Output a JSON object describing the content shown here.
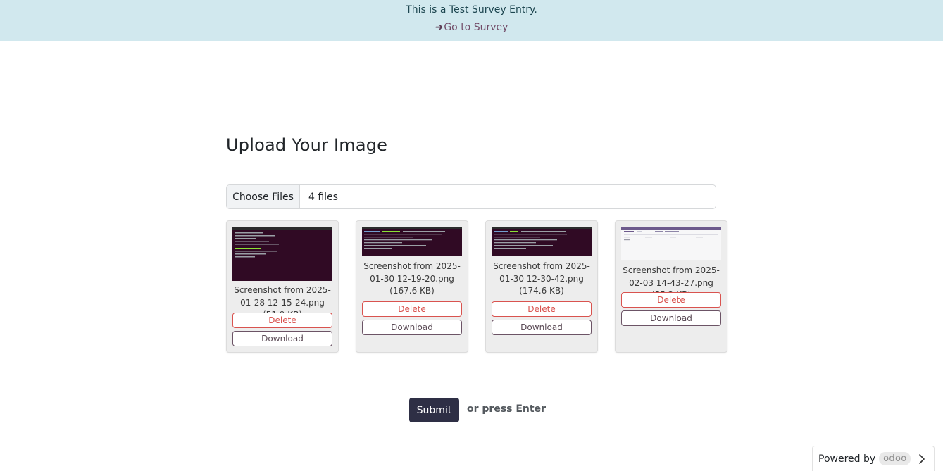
{
  "banner": {
    "text": "This is a Test Survey Entry.",
    "link_label": "Go to Survey",
    "arrow": "➜"
  },
  "page": {
    "title": "Upload Your Image"
  },
  "file_input": {
    "button_label": "Choose Files",
    "value": "4 files"
  },
  "files": [
    {
      "caption": "Screenshot from 2025-01-28 12-15-24.png (51.9 KB)",
      "thumb_style": "dark",
      "delete_label": "Delete",
      "download_label": "Download"
    },
    {
      "caption": "Screenshot from 2025-01-30 12-19-20.png (167.6 KB)",
      "thumb_style": "dark",
      "delete_label": "Delete",
      "download_label": "Download"
    },
    {
      "caption": "Screenshot from 2025-01-30 12-30-42.png (174.6 KB)",
      "thumb_style": "dark",
      "delete_label": "Delete",
      "download_label": "Download"
    },
    {
      "caption": "Screenshot from 2025-02-03 14-43-27.png (55.2 KB)",
      "thumb_style": "light",
      "delete_label": "Delete",
      "download_label": "Download"
    }
  ],
  "actions": {
    "submit_label": "Submit",
    "hint": "or press Enter"
  },
  "footer": {
    "powered_by": "Powered by",
    "brand": "odoo"
  },
  "colors": {
    "banner_bg": "#d1e8ee",
    "link": "#714b67",
    "delete": "#d9534f",
    "submit_bg": "#2e2f45",
    "terminal_bg": "#300a24"
  },
  "icons": {
    "banner_arrow": "arrow-right-icon",
    "footer_chevron": "chevron-right-icon"
  }
}
